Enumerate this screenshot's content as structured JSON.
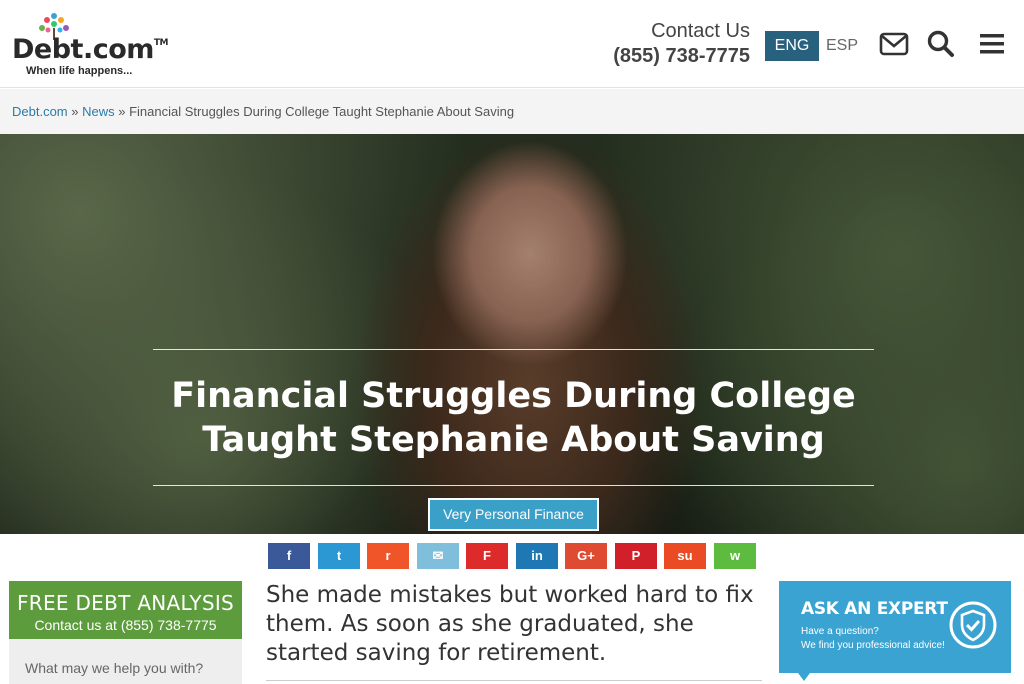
{
  "header": {
    "logo_text": "Debt.com",
    "logo_tm": "TM",
    "logo_tagline": "When life happens...",
    "contact_label": "Contact Us",
    "contact_phone": "(855) 738-7775",
    "lang_active": "ENG",
    "lang_other": "ESP"
  },
  "breadcrumb": {
    "home": "Debt.com",
    "sep1": " » ",
    "section": "News",
    "sep2": " » ",
    "current": "Financial Struggles During College Taught Stephanie About Saving"
  },
  "hero": {
    "title_line1": "Financial Struggles During College",
    "title_line2": "Taught Stephanie About Saving",
    "category": "Very Personal Finance"
  },
  "share": [
    {
      "name": "facebook",
      "glyph": "f",
      "color": "#3b5998"
    },
    {
      "name": "twitter",
      "glyph": "t",
      "color": "#2b98d4"
    },
    {
      "name": "reddit",
      "glyph": "r",
      "color": "#f0552a"
    },
    {
      "name": "email",
      "glyph": "✉",
      "color": "#7fbfdc"
    },
    {
      "name": "flipboard",
      "glyph": "F",
      "color": "#dd2b2b"
    },
    {
      "name": "linkedin",
      "glyph": "in",
      "color": "#1f78b4"
    },
    {
      "name": "googleplus",
      "glyph": "G+",
      "color": "#df4a32"
    },
    {
      "name": "pinterest",
      "glyph": "P",
      "color": "#d1202a"
    },
    {
      "name": "stumbleupon",
      "glyph": "su",
      "color": "#ea4b24"
    },
    {
      "name": "whatsapp",
      "glyph": "w",
      "color": "#5dbb3f"
    }
  ],
  "sidebar": {
    "free_title": "FREE DEBT ANALYSIS",
    "free_sub": "Contact us at (855) 738-7775",
    "help_prompt": "What may we help you with?"
  },
  "article": {
    "lede": "She made mistakes but worked hard to fix them. As soon as she graduated, she started saving for retirement."
  },
  "expert": {
    "title": "ASK AN EXPERT",
    "line1": "Have a question?",
    "line2": "We find you professional advice!"
  }
}
